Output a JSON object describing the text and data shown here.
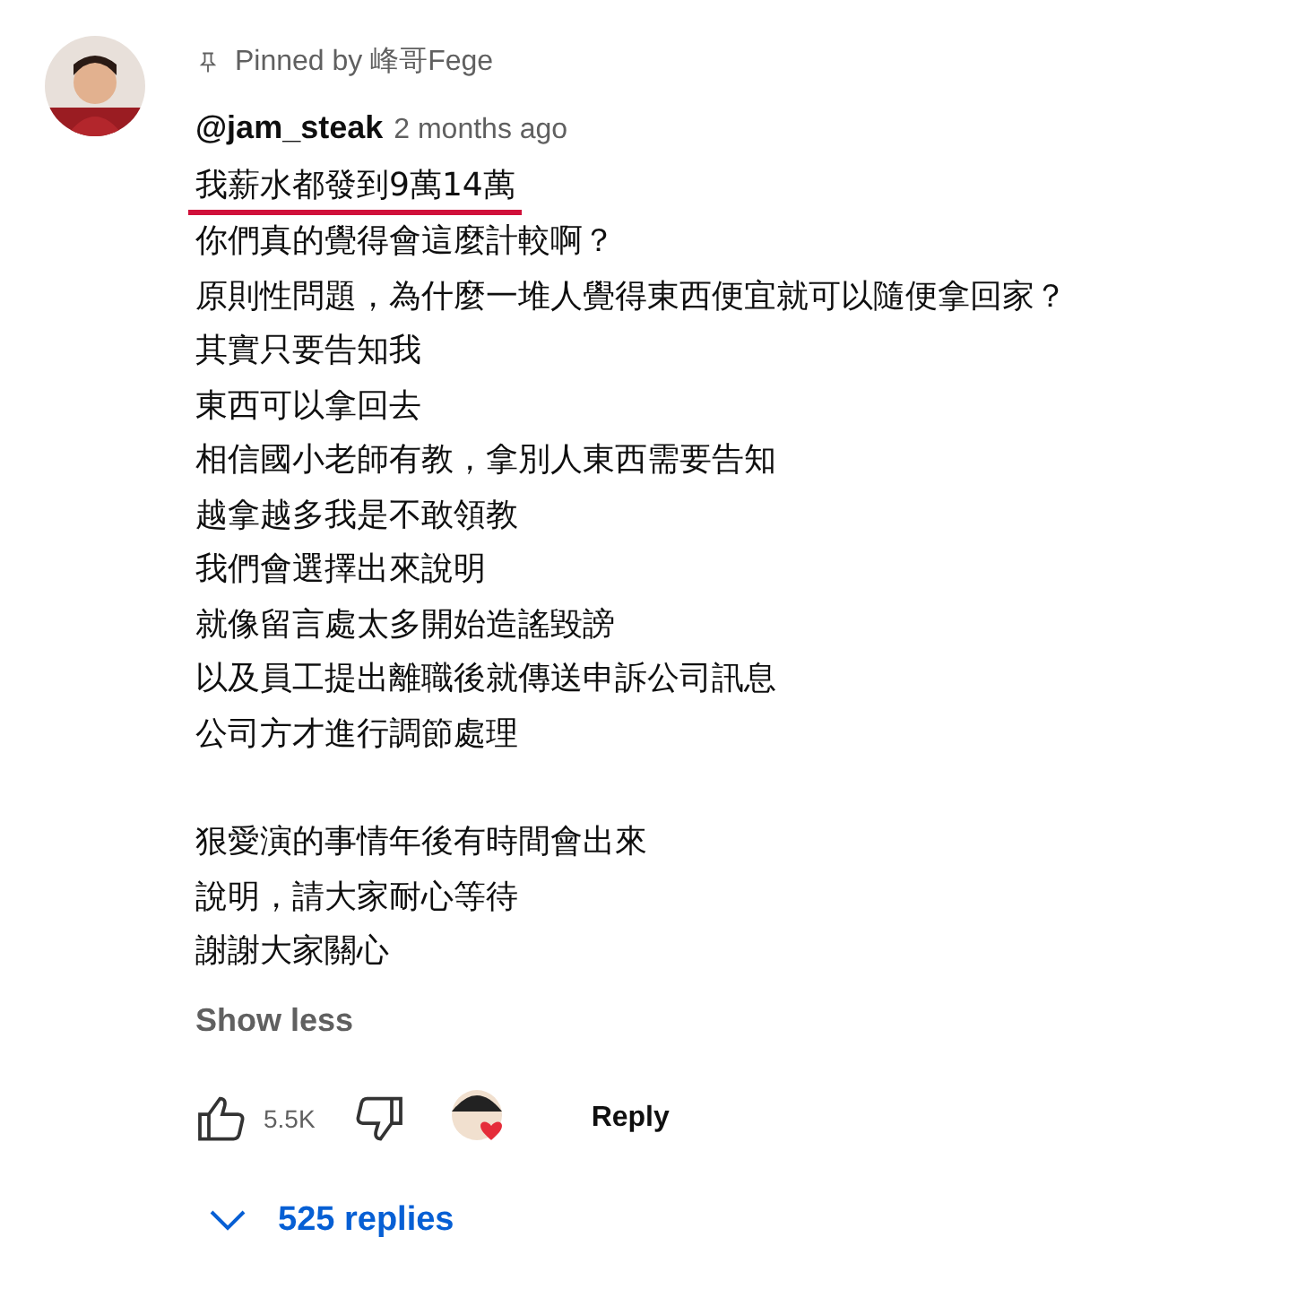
{
  "comment": {
    "pinned_label": "Pinned by 峰哥Fege",
    "author": "@jam_steak",
    "time": "2 months ago",
    "paragraphs": [
      {
        "lines": [
          {
            "text": "我薪水都發到9萬14萬",
            "underlined": true
          },
          {
            "text": "你們真的覺得會這麼計較啊？",
            "underlined": false
          },
          {
            "text": "原則性問題，為什麼一堆人覺得東西便宜就可以隨便拿回家？",
            "underlined": false
          },
          {
            "text": "其實只要告知我",
            "underlined": false
          },
          {
            "text": "東西可以拿回去",
            "underlined": false
          },
          {
            "text": "相信國小老師有教，拿別人東西需要告知",
            "underlined": false
          },
          {
            "text": "越拿越多我是不敢領教",
            "underlined": false
          },
          {
            "text": "我們會選擇出來說明",
            "underlined": false
          },
          {
            "text": "就像留言處太多開始造謠毀謗",
            "underlined": false
          },
          {
            "text": "以及員工提出離職後就傳送申訴公司訊息",
            "underlined": false
          },
          {
            "text": "公司方才進行調節處理",
            "underlined": false
          }
        ]
      },
      {
        "lines": [
          {
            "text": "狠愛演的事情年後有時間會出來",
            "underlined": false
          },
          {
            "text": "說明，請大家耐心等待",
            "underlined": false
          },
          {
            "text": "謝謝大家關心",
            "underlined": false
          }
        ]
      }
    ],
    "show_less": "Show less",
    "likes": "5.5K",
    "creator_hearted": true,
    "reply": "Reply",
    "replies": "525 replies"
  }
}
